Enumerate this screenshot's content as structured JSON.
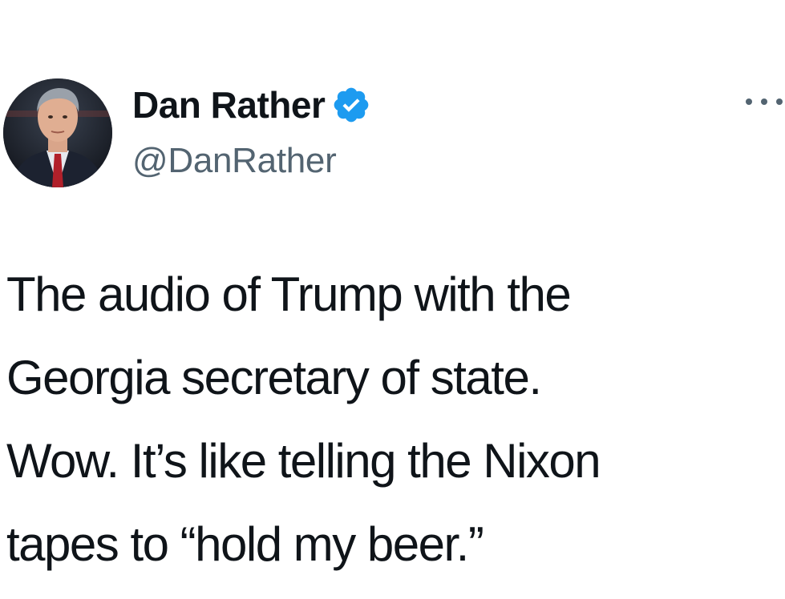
{
  "author": {
    "display_name": "Dan Rather",
    "handle": "@DanRather",
    "verified": true,
    "avatar_icon": "profile-photo",
    "verified_icon": "verified-badge-icon"
  },
  "menu": {
    "icon": "more-options-icon"
  },
  "tweet": {
    "lines": [
      "The audio of Trump with the",
      "Georgia secretary of state.",
      "Wow. It’s like telling the Nixon",
      "tapes to “hold my beer.”"
    ]
  },
  "colors": {
    "text_primary": "#0f1419",
    "text_secondary": "#536471",
    "verified_blue": "#1d9bf0",
    "background": "#ffffff"
  }
}
